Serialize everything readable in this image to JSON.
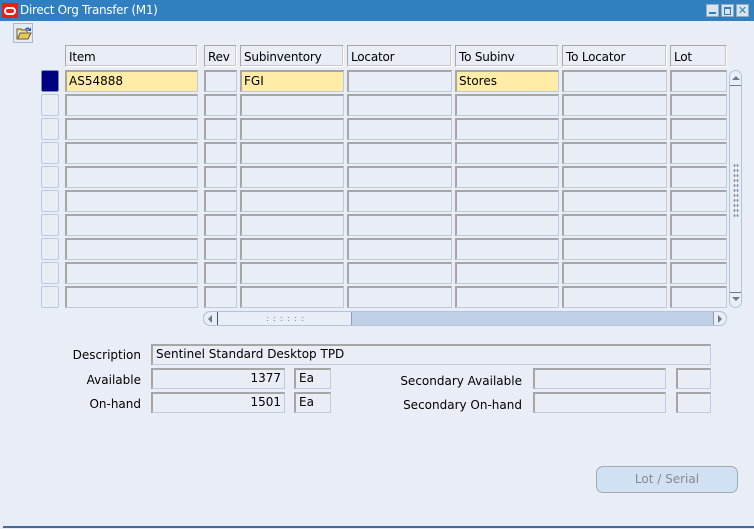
{
  "window": {
    "title": "Direct Org Transfer (M1)",
    "controls": [
      "minimize",
      "maximize",
      "close"
    ],
    "close_glyph": "✕"
  },
  "toolbar": {
    "open_button_icon": "folder-open-icon"
  },
  "grid": {
    "columns": [
      {
        "key": "item",
        "label": "Item"
      },
      {
        "key": "rev",
        "label": "Rev"
      },
      {
        "key": "subinventory",
        "label": "Subinventory"
      },
      {
        "key": "locator",
        "label": "Locator"
      },
      {
        "key": "to_subinv",
        "label": "To Subinv"
      },
      {
        "key": "to_locator",
        "label": "To Locator"
      },
      {
        "key": "lot",
        "label": "Lot"
      }
    ],
    "rows": [
      {
        "item": "AS54888",
        "rev": "",
        "subinventory": "FGI",
        "locator": "",
        "to_subinv": "Stores",
        "to_locator": "",
        "lot": "",
        "current": true
      },
      {
        "item": "",
        "rev": "",
        "subinventory": "",
        "locator": "",
        "to_subinv": "",
        "to_locator": "",
        "lot": ""
      },
      {
        "item": "",
        "rev": "",
        "subinventory": "",
        "locator": "",
        "to_subinv": "",
        "to_locator": "",
        "lot": ""
      },
      {
        "item": "",
        "rev": "",
        "subinventory": "",
        "locator": "",
        "to_subinv": "",
        "to_locator": "",
        "lot": ""
      },
      {
        "item": "",
        "rev": "",
        "subinventory": "",
        "locator": "",
        "to_subinv": "",
        "to_locator": "",
        "lot": ""
      },
      {
        "item": "",
        "rev": "",
        "subinventory": "",
        "locator": "",
        "to_subinv": "",
        "to_locator": "",
        "lot": ""
      },
      {
        "item": "",
        "rev": "",
        "subinventory": "",
        "locator": "",
        "to_subinv": "",
        "to_locator": "",
        "lot": ""
      },
      {
        "item": "",
        "rev": "",
        "subinventory": "",
        "locator": "",
        "to_subinv": "",
        "to_locator": "",
        "lot": ""
      },
      {
        "item": "",
        "rev": "",
        "subinventory": "",
        "locator": "",
        "to_subinv": "",
        "to_locator": "",
        "lot": ""
      },
      {
        "item": "",
        "rev": "",
        "subinventory": "",
        "locator": "",
        "to_subinv": "",
        "to_locator": "",
        "lot": ""
      }
    ]
  },
  "details": {
    "description_label": "Description",
    "description_value": "Sentinel Standard Desktop TPD",
    "available_label": "Available",
    "available_value": "1377",
    "available_uom": "Ea",
    "onhand_label": "On-hand",
    "onhand_value": "1501",
    "onhand_uom": "Ea",
    "sec_available_label": "Secondary Available",
    "sec_available_value": "",
    "sec_available_uom": "",
    "sec_onhand_label": "Secondary On-hand",
    "sec_onhand_value": "",
    "sec_onhand_uom": ""
  },
  "buttons": {
    "lot_serial": "Lot / Serial"
  },
  "colors": {
    "titlebar": "#2f7fc1",
    "background": "#e9eef6",
    "required_field": "#ffeda7",
    "current_record": "#000080"
  }
}
